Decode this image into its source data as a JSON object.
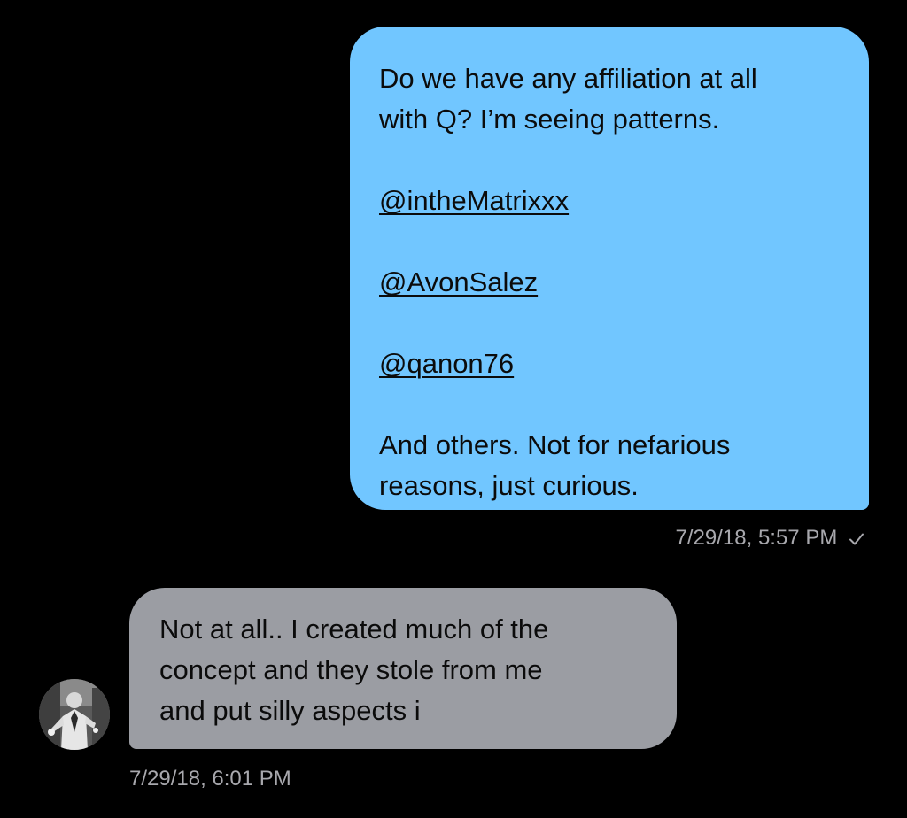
{
  "conversation": {
    "outgoing_message": {
      "lines": [
        "Do we have any affiliation at all",
        "with Q?  I’m seeing patterns."
      ],
      "mentions": [
        "@intheMatrixxx",
        "@AvonSalez",
        "@qanon76"
      ],
      "closing_lines": [
        "And others. Not for nefarious",
        "reasons, just curious."
      ],
      "timestamp": "7/29/18, 5:57 PM",
      "status_icon": "checkmark-icon",
      "bubble_color": "#71c6ff"
    },
    "incoming_message": {
      "lines": [
        "Not at all..  I created much of the",
        "concept and they stole from me",
        "and put silly aspects i"
      ],
      "timestamp": "7/29/18, 6:01 PM",
      "avatar_icon": "user-avatar",
      "bubble_color": "#9b9da3"
    },
    "background_color": "#000000",
    "meta_text_color": "#a8a8ad"
  }
}
